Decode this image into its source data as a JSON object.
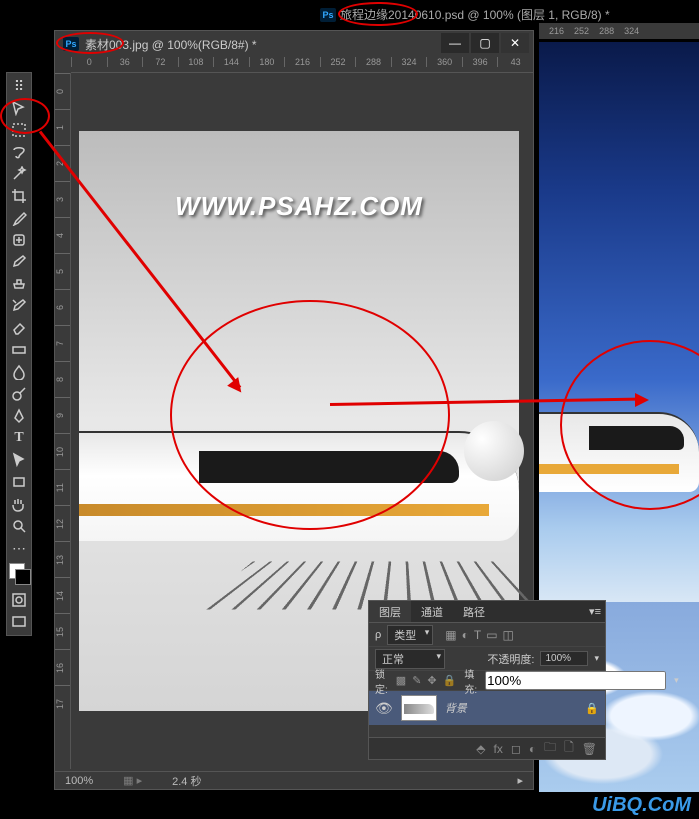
{
  "main_tab": {
    "title": "旅程边缘20140610.psd @ 100% (图层 1, RGB/8) *"
  },
  "ruler_top_main": [
    "216",
    "252",
    "288",
    "324"
  ],
  "sub_window": {
    "title": "素材003.jpg @ 100%(RGB/8#) *",
    "ruler_h": [
      "0",
      "36",
      "72",
      "108",
      "144",
      "180",
      "216",
      "252",
      "288",
      "324",
      "360",
      "396",
      "43"
    ],
    "ruler_v": [
      "0",
      "1",
      "2",
      "3",
      "4",
      "5",
      "6",
      "7",
      "8",
      "9",
      "10",
      "11",
      "12",
      "13",
      "14",
      "15",
      "16",
      "17"
    ],
    "status_zoom": "100%",
    "status_time": "2.4 秒"
  },
  "watermark": "WWW.PSAHZ.COM",
  "layers_panel": {
    "tabs": [
      "图层",
      "通道",
      "路径"
    ],
    "kind_label": "类型",
    "search_icon": "ρ",
    "blend_mode": "正常",
    "opacity_label": "不透明度:",
    "opacity_value": "100%",
    "lock_label": "锁定:",
    "fill_label": "填充:",
    "fill_value": "100%",
    "layer_name": "背景"
  },
  "tool_names": [
    "move-tool",
    "marquee-tool",
    "lasso-tool",
    "magic-wand-tool",
    "crop-tool",
    "eyedropper-tool",
    "healing-brush-tool",
    "brush-tool",
    "clone-stamp-tool",
    "history-brush-tool",
    "eraser-tool",
    "gradient-tool",
    "blur-tool",
    "dodge-tool",
    "pen-tool",
    "type-tool",
    "path-selection-tool",
    "rectangle-tool",
    "hand-tool",
    "zoom-tool"
  ],
  "uibq": "UiBQ.CoM"
}
